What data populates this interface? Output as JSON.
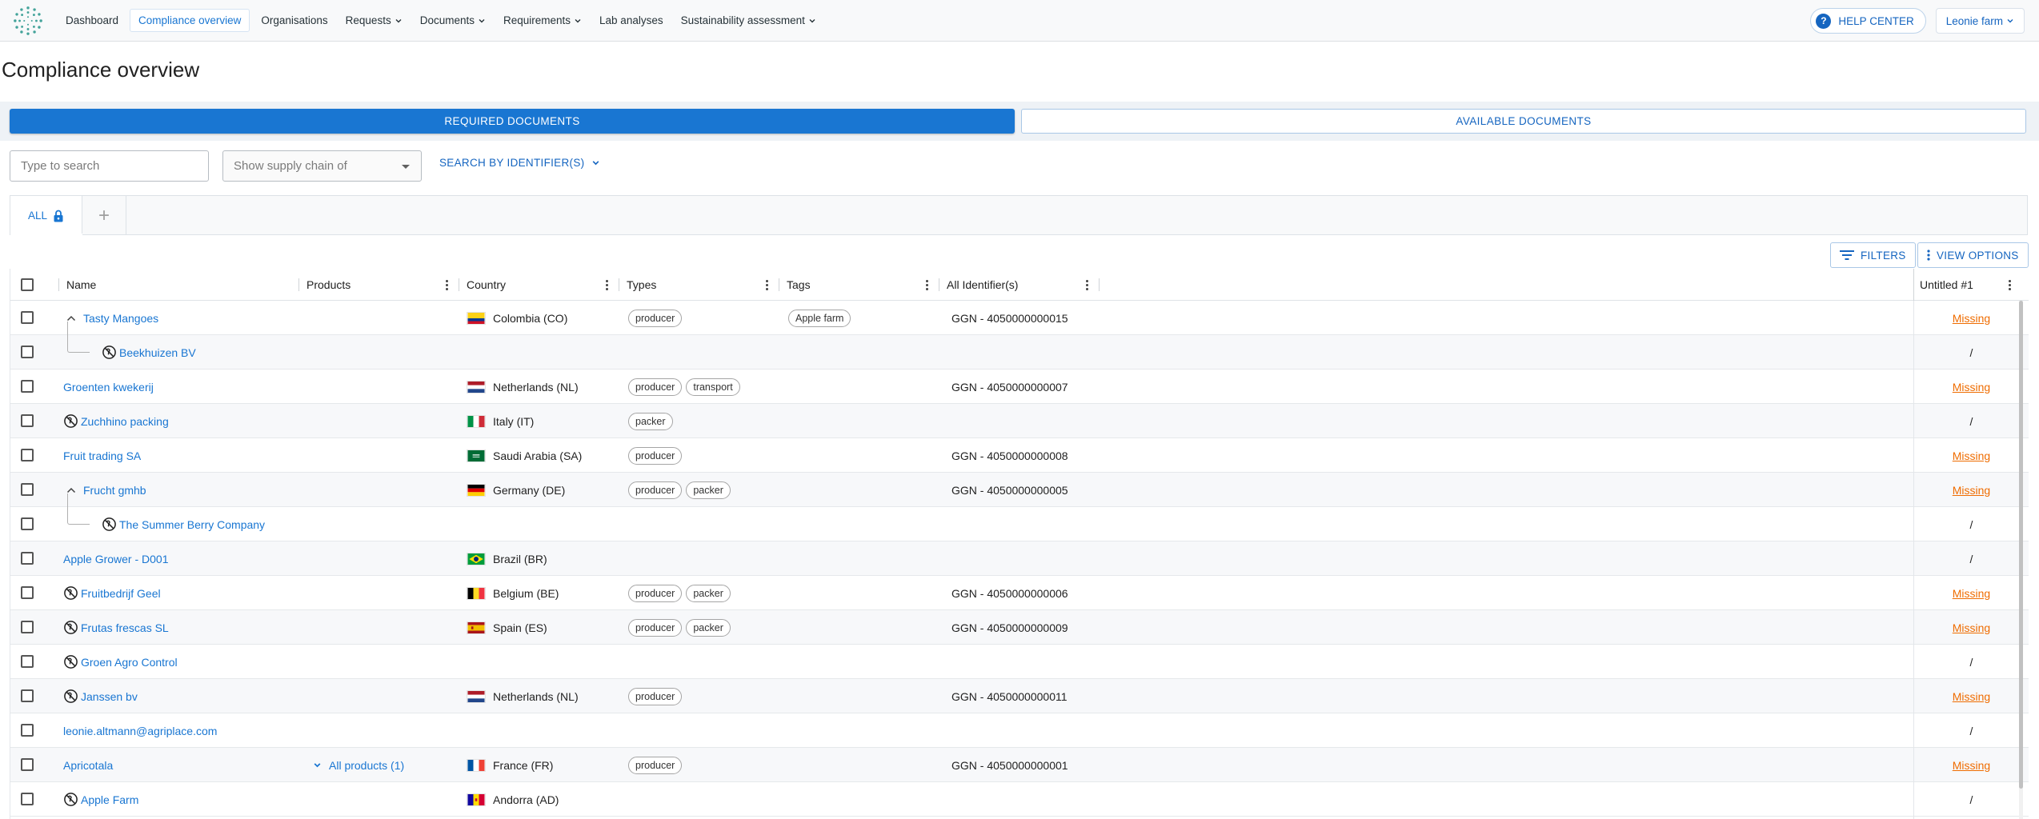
{
  "nav": {
    "items": [
      {
        "label": "Dashboard",
        "dropdown": false,
        "active": false
      },
      {
        "label": "Compliance overview",
        "dropdown": false,
        "active": true
      },
      {
        "label": "Organisations",
        "dropdown": false,
        "active": false
      },
      {
        "label": "Requests",
        "dropdown": true,
        "active": false
      },
      {
        "label": "Documents",
        "dropdown": true,
        "active": false
      },
      {
        "label": "Requirements",
        "dropdown": true,
        "active": false
      },
      {
        "label": "Lab analyses",
        "dropdown": false,
        "active": false
      },
      {
        "label": "Sustainability assessment",
        "dropdown": true,
        "active": false
      }
    ],
    "help_label": "HELP CENTER",
    "user_label": "Leonie farm"
  },
  "page": {
    "title": "Compliance overview"
  },
  "doc_toggle": {
    "required": "REQUIRED DOCUMENTS",
    "available": "AVAILABLE DOCUMENTS"
  },
  "filters": {
    "search_placeholder": "Type to search",
    "supply_chain_placeholder": "Show supply chain of",
    "identifier_label": "SEARCH BY IDENTIFIER(S)"
  },
  "tabs": {
    "all_label": "ALL",
    "add_label": "+"
  },
  "toolbar": {
    "filters_label": "FILTERS",
    "view_options_label": "VIEW OPTIONS"
  },
  "table": {
    "columns": [
      "Name",
      "Products",
      "Country",
      "Types",
      "Tags",
      "All Identifier(s)",
      "Untitled #1"
    ],
    "rows": [
      {
        "name": "Tasty Mangoes",
        "expanded": true,
        "child": false,
        "slash": false,
        "products": "",
        "country": "Colombia (CO)",
        "flag": "CO",
        "types": [
          "producer"
        ],
        "tags": [
          "Apple farm"
        ],
        "identifier": "GGN - 4050000000015",
        "status": "Missing"
      },
      {
        "name": "Beekhuizen BV",
        "expanded": false,
        "child": true,
        "slash": true,
        "products": "",
        "country": "",
        "flag": "",
        "types": [],
        "tags": [],
        "identifier": "",
        "status": "/"
      },
      {
        "name": "Groenten kwekerij",
        "expanded": false,
        "child": false,
        "slash": false,
        "products": "",
        "country": "Netherlands (NL)",
        "flag": "NL",
        "types": [
          "producer",
          "transport"
        ],
        "tags": [],
        "identifier": "GGN - 4050000000007",
        "status": "Missing"
      },
      {
        "name": "Zuchhino packing",
        "expanded": false,
        "child": false,
        "slash": true,
        "products": "",
        "country": "Italy (IT)",
        "flag": "IT",
        "types": [
          "packer"
        ],
        "tags": [],
        "identifier": "",
        "status": "/"
      },
      {
        "name": "Fruit trading SA",
        "expanded": false,
        "child": false,
        "slash": false,
        "products": "",
        "country": "Saudi Arabia (SA)",
        "flag": "SA",
        "types": [
          "producer"
        ],
        "tags": [],
        "identifier": "GGN - 4050000000008",
        "status": "Missing"
      },
      {
        "name": "Frucht gmhb",
        "expanded": true,
        "child": false,
        "slash": false,
        "products": "",
        "country": "Germany (DE)",
        "flag": "DE",
        "types": [
          "producer",
          "packer"
        ],
        "tags": [],
        "identifier": "GGN - 4050000000005",
        "status": "Missing"
      },
      {
        "name": "The Summer Berry Company",
        "expanded": false,
        "child": true,
        "slash": true,
        "products": "",
        "country": "",
        "flag": "",
        "types": [],
        "tags": [],
        "identifier": "",
        "status": "/"
      },
      {
        "name": "Apple Grower - D001",
        "expanded": false,
        "child": false,
        "slash": false,
        "products": "",
        "country": "Brazil (BR)",
        "flag": "BR",
        "types": [],
        "tags": [],
        "identifier": "",
        "status": "/"
      },
      {
        "name": "Fruitbedrijf Geel",
        "expanded": false,
        "child": false,
        "slash": true,
        "products": "",
        "country": "Belgium (BE)",
        "flag": "BE",
        "types": [
          "producer",
          "packer"
        ],
        "tags": [],
        "identifier": "GGN - 4050000000006",
        "status": "Missing"
      },
      {
        "name": "Frutas frescas SL",
        "expanded": false,
        "child": false,
        "slash": true,
        "products": "",
        "country": "Spain (ES)",
        "flag": "ES",
        "types": [
          "producer",
          "packer"
        ],
        "tags": [],
        "identifier": "GGN - 4050000000009",
        "status": "Missing"
      },
      {
        "name": "Groen Agro Control",
        "expanded": false,
        "child": false,
        "slash": true,
        "products": "",
        "country": "",
        "flag": "",
        "types": [],
        "tags": [],
        "identifier": "",
        "status": "/"
      },
      {
        "name": "Janssen bv",
        "expanded": false,
        "child": false,
        "slash": true,
        "products": "",
        "country": "Netherlands (NL)",
        "flag": "NL",
        "types": [
          "producer"
        ],
        "tags": [],
        "identifier": "GGN - 4050000000011",
        "status": "Missing"
      },
      {
        "name": "leonie.altmann@agriplace.com",
        "expanded": false,
        "child": false,
        "slash": false,
        "products": "",
        "country": "",
        "flag": "",
        "types": [],
        "tags": [],
        "identifier": "",
        "status": "/"
      },
      {
        "name": "Apricotala",
        "expanded": false,
        "child": false,
        "slash": false,
        "products": "All products (1)",
        "country": "France (FR)",
        "flag": "FR",
        "types": [
          "producer"
        ],
        "tags": [],
        "identifier": "GGN - 4050000000001",
        "status": "Missing"
      },
      {
        "name": "Apple Farm",
        "expanded": false,
        "child": false,
        "slash": true,
        "products": "",
        "country": "Andorra (AD)",
        "flag": "AD",
        "types": [],
        "tags": [],
        "identifier": "",
        "status": "/"
      }
    ]
  },
  "colors": {
    "primary": "#1976d2",
    "missing": "#ef6c00",
    "border": "#dfe3e7"
  }
}
